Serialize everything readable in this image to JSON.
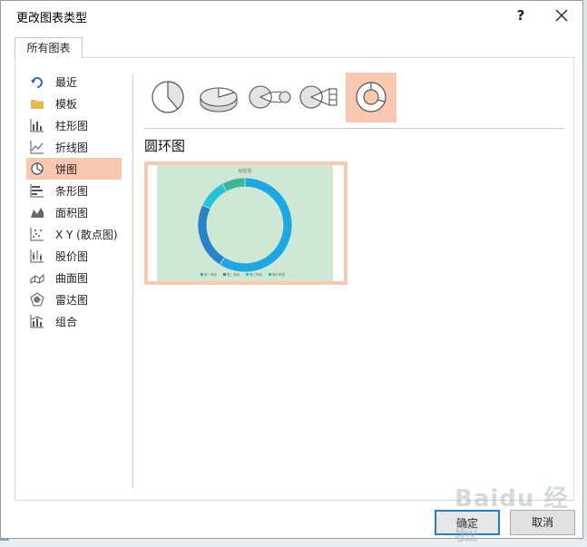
{
  "dialog": {
    "title": "更改图表类型",
    "help_label": "?",
    "close_icon": "close-icon"
  },
  "tabs": [
    {
      "label": "所有图表"
    }
  ],
  "sidebar": {
    "items": [
      {
        "label": "最近",
        "icon": "recent-icon"
      },
      {
        "label": "模板",
        "icon": "folder-icon"
      },
      {
        "label": "柱形图",
        "icon": "column-chart-icon"
      },
      {
        "label": "折线图",
        "icon": "line-chart-icon"
      },
      {
        "label": "饼图",
        "icon": "pie-chart-icon",
        "selected": true
      },
      {
        "label": "条形图",
        "icon": "bar-chart-icon"
      },
      {
        "label": "面积图",
        "icon": "area-chart-icon"
      },
      {
        "label": "X Y (散点图)",
        "icon": "scatter-chart-icon"
      },
      {
        "label": "股价图",
        "icon": "stock-chart-icon"
      },
      {
        "label": "曲面图",
        "icon": "surface-chart-icon"
      },
      {
        "label": "雷达图",
        "icon": "radar-chart-icon"
      },
      {
        "label": "组合",
        "icon": "combo-chart-icon"
      }
    ]
  },
  "subtypes": [
    {
      "icon": "pie-icon"
    },
    {
      "icon": "3d-pie-icon"
    },
    {
      "icon": "pie-of-pie-icon"
    },
    {
      "icon": "bar-of-pie-icon"
    },
    {
      "icon": "doughnut-icon",
      "selected": true
    }
  ],
  "section": {
    "title": "圆环图"
  },
  "preview": {
    "chart_title": "销售额",
    "legend": [
      "第一季度",
      "第二季度",
      "第三季度",
      "第四季度"
    ]
  },
  "chart_data": {
    "type": "pie",
    "subtype": "doughnut",
    "title": "销售额",
    "categories": [
      "第一季度",
      "第二季度",
      "第三季度",
      "第四季度"
    ],
    "values": [
      59,
      23,
      10,
      8
    ],
    "colors": [
      "#1da7e3",
      "#2a82c8",
      "#28c2d6",
      "#3cb69a"
    ],
    "legend_position": "bottom",
    "background": "#cfe8d3"
  },
  "footer": {
    "ok_label": "确定",
    "cancel_label": "取消"
  },
  "colors": {
    "selection": "#f8c8b0",
    "accent": "#2a7bd0"
  },
  "watermark": "Baidu 经验"
}
